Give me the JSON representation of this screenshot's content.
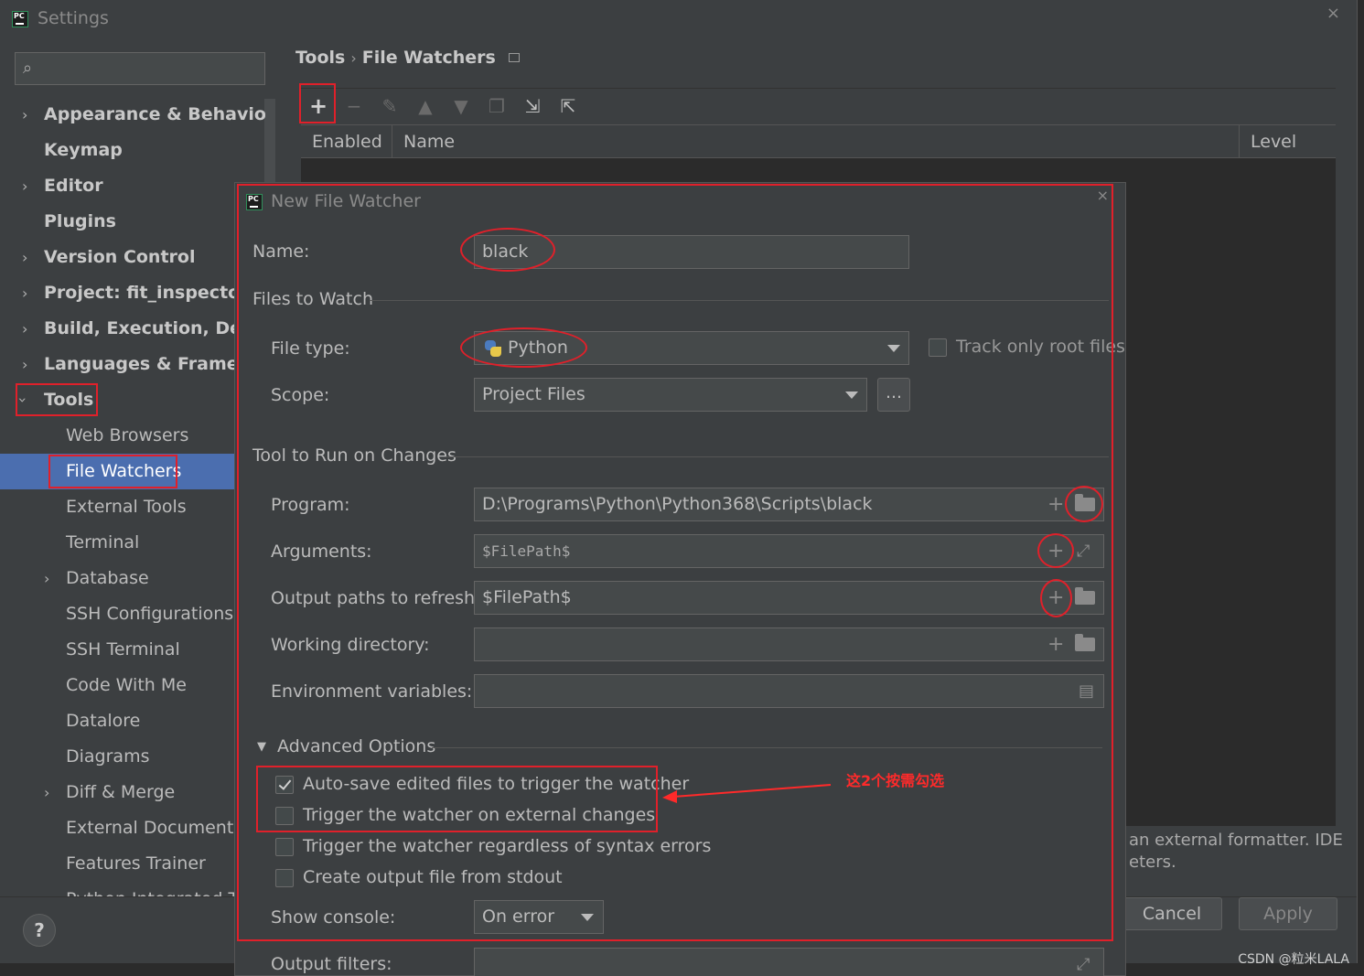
{
  "window": {
    "title": "Settings",
    "close": "×"
  },
  "sidebar": {
    "search_placeholder": "",
    "items": [
      {
        "label": "Appearance & Behavior",
        "has_chevron": true
      },
      {
        "label": "Keymap"
      },
      {
        "label": "Editor",
        "has_chevron": true
      },
      {
        "label": "Plugins"
      },
      {
        "label": "Version Control",
        "has_chevron": true
      },
      {
        "label": "Project: fit_inspector",
        "has_chevron": true
      },
      {
        "label": "Build, Execution, Deployment",
        "has_chevron": true
      },
      {
        "label": "Languages & Frameworks",
        "has_chevron": true
      },
      {
        "label": "Tools",
        "expanded": true
      },
      {
        "label": "Web Browsers"
      },
      {
        "label": "File Watchers",
        "selected": true
      },
      {
        "label": "External Tools"
      },
      {
        "label": "Terminal"
      },
      {
        "label": "Database",
        "has_chevron": true
      },
      {
        "label": "SSH Configurations"
      },
      {
        "label": "SSH Terminal"
      },
      {
        "label": "Code With Me"
      },
      {
        "label": "Datalore"
      },
      {
        "label": "Diagrams"
      },
      {
        "label": "Diff & Merge",
        "has_chevron": true
      },
      {
        "label": "External Documentation"
      },
      {
        "label": "Features Trainer"
      },
      {
        "label": "Python Integrated Tools"
      }
    ]
  },
  "breadcrumb": {
    "parent": "Tools",
    "separator": "›",
    "current": "File Watchers"
  },
  "table": {
    "columns": [
      "Enabled",
      "Name",
      "Level"
    ]
  },
  "background_text": {
    "line1": "an external formatter. IDE",
    "line2": "eters."
  },
  "buttons": {
    "help": "?",
    "cancel": "Cancel",
    "apply": "Apply"
  },
  "watermark": "CSDN @粒米LALA",
  "dialog": {
    "title": "New File Watcher",
    "close": "×",
    "name_label": "Name:",
    "name_value": "black",
    "files_to_watch": "Files to Watch",
    "file_type_label": "File type:",
    "file_type_value": "Python",
    "track_root_label": "Track only root files",
    "track_root_checked": false,
    "scope_label": "Scope:",
    "scope_value": "Project Files",
    "scope_dots": "...",
    "tool_section": "Tool to Run on Changes",
    "program_label": "Program:",
    "program_value": "D:\\Programs\\Python\\Python368\\Scripts\\black",
    "arguments_label": "Arguments:",
    "arguments_value": "$FilePath$",
    "output_label": "Output paths to refresh:",
    "output_value": "$FilePath$",
    "workdir_label": "Working directory:",
    "workdir_value": "",
    "env_label": "Environment variables:",
    "env_value": "",
    "advanced_label": "Advanced Options",
    "options": [
      {
        "label": "Auto-save edited files to trigger the watcher",
        "checked": true
      },
      {
        "label": "Trigger the watcher on external changes",
        "checked": false
      },
      {
        "label": "Trigger the watcher regardless of syntax errors",
        "checked": false
      },
      {
        "label": "Create output file from stdout",
        "checked": false
      }
    ],
    "show_console_label": "Show console:",
    "show_console_value": "On error",
    "output_filters_label": "Output filters:"
  },
  "annotation": {
    "text": "这2个按需勾选",
    "color": "#ff2a2a"
  },
  "colors": {
    "selection": "#4b6eaf",
    "highlight": "#e0202a",
    "panel": "#3c3f41",
    "background": "#2b2b2b"
  }
}
